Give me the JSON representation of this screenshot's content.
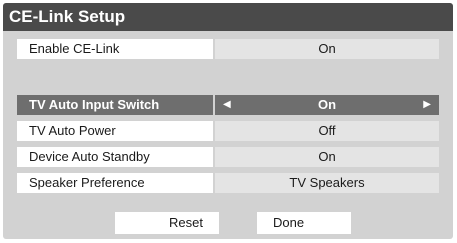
{
  "dialog": {
    "title": "CE-Link Setup"
  },
  "rows": [
    {
      "label": "Enable CE-Link",
      "value": "On"
    },
    {
      "label": "TV Auto Input Switch",
      "value": "On",
      "selected": true
    },
    {
      "label": "TV Auto Power",
      "value": "Off"
    },
    {
      "label": "Device Auto Standby",
      "value": "On"
    },
    {
      "label": "Speaker Preference",
      "value": "TV Speakers"
    }
  ],
  "buttons": {
    "reset": "Reset",
    "done": "Done"
  },
  "icons": {
    "left": "triangle-left-icon",
    "right": "triangle-right-icon"
  },
  "colors": {
    "title_bar": "#4a4a4a",
    "panel": "#d2d2d2",
    "selected_row": "#6e6e6e"
  }
}
